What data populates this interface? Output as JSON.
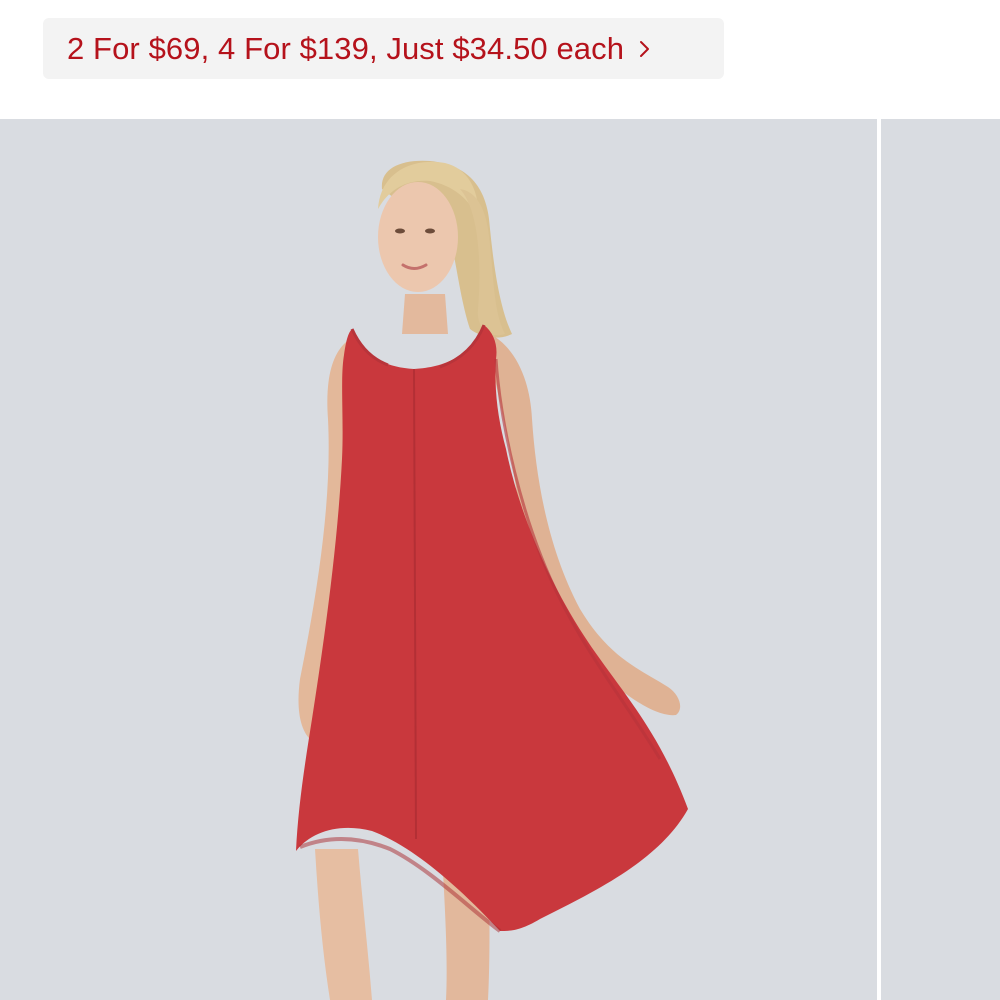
{
  "promo": {
    "text": "2 For $69, 4 For $139, Just $34.50 each",
    "text_color": "#b5121b",
    "background_color": "#f3f3f3",
    "icon": "chevron-right-icon"
  },
  "gallery": {
    "background_color": "#d9dce1",
    "main_image": {
      "subject": "model wearing red sleeveless racerback high-low dress",
      "dress_color": "#c9383d"
    },
    "next_image_peek": true
  }
}
